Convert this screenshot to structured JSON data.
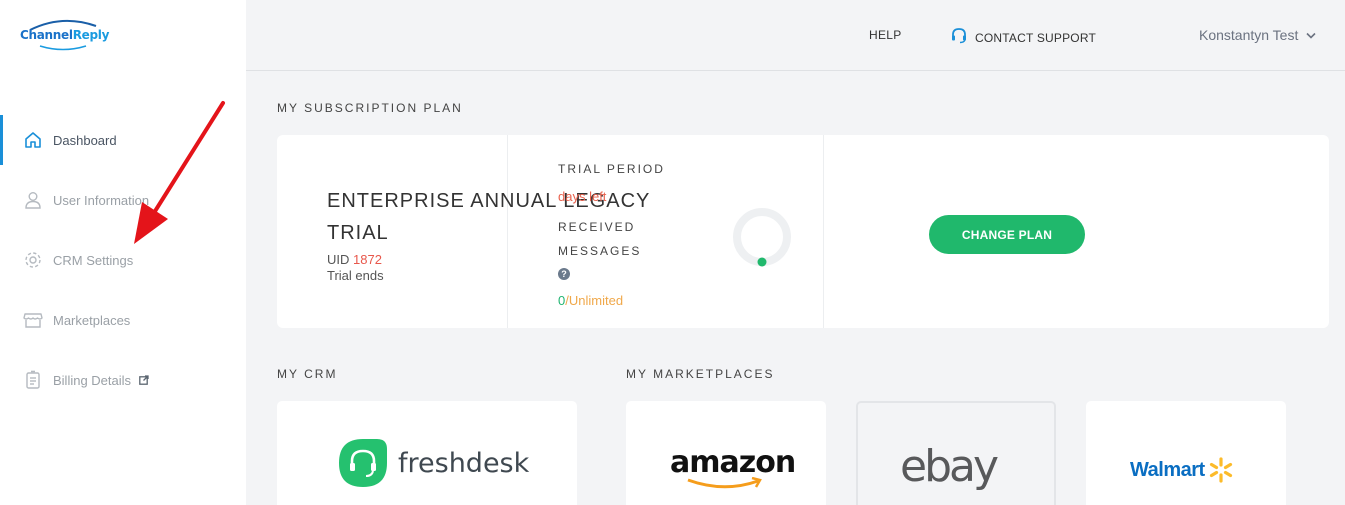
{
  "brand": {
    "part1": "Channel",
    "part2": "Reply"
  },
  "sidebar": {
    "items": [
      {
        "label": "Dashboard",
        "icon": "home-icon",
        "active": true
      },
      {
        "label": "User Information",
        "icon": "user-icon"
      },
      {
        "label": "CRM Settings",
        "icon": "gear-icon"
      },
      {
        "label": "Marketplaces",
        "icon": "store-icon"
      },
      {
        "label": "Billing Details",
        "icon": "billing-icon",
        "external": true
      }
    ]
  },
  "header": {
    "help": "HELP",
    "contact_support": "CONTACT SUPPORT",
    "user_name": "Konstantyn Test"
  },
  "subscription": {
    "section_title": "MY SUBSCRIPTION PLAN",
    "plan_name": "ENTERPRISE ANNUAL LEGACY TRIAL",
    "uid_label": "UID",
    "uid_value": "1872",
    "trial_ends": "Trial ends",
    "trial_period_label": "TRIAL PERIOD",
    "days_left": "days left",
    "received_messages_label": "RECEIVED MESSAGES",
    "help_mark": "?",
    "messages_used": "0",
    "messages_separator": "/",
    "messages_limit": "Unlimited",
    "change_plan": "CHANGE PLAN"
  },
  "crm": {
    "section_title": "MY CRM",
    "name": "freshdesk"
  },
  "marketplaces": {
    "section_title": "MY MARKETPLACES",
    "items": [
      "amazon",
      "ebay",
      "Walmart"
    ]
  },
  "colors": {
    "accent": "#1a8fd8",
    "green": "#20b86c",
    "red": "#e8584c",
    "orange": "#f0a84a",
    "annotation_arrow": "#e4141a"
  }
}
